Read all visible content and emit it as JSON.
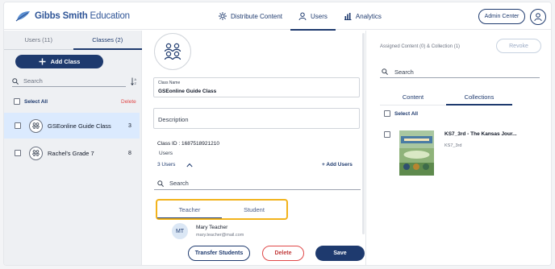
{
  "app": {
    "logo_bold": "Gibbs Smith",
    "logo_rest": " Education"
  },
  "nav": {
    "distribute": "Distribute Content",
    "users": "Users",
    "analytics": "Analytics",
    "admin_center": "Admin Center"
  },
  "left": {
    "tab_users": "Users (11)",
    "tab_classes": "Classes (2)",
    "add_class": "Add Class",
    "search_placeholder": "Search",
    "select_all": "Select All",
    "delete": "Delete",
    "classes": [
      {
        "name": "GSEonline Guide Class",
        "count": "3"
      },
      {
        "name": "Rachel's Grade 7",
        "count": "8"
      }
    ]
  },
  "detail": {
    "class_name_label": "Class Name",
    "class_name_value": "GSEonline Guide Class",
    "description_placeholder": "Description",
    "class_id": "Class ID : 1687518921210",
    "users_label": "Users",
    "users_count": "3 Users",
    "add_users": "+ Add Users",
    "search_placeholder": "Search",
    "role_teacher": "Teacher",
    "role_student": "Student",
    "member": {
      "initials": "MT",
      "name": "Mary Teacher",
      "email": "mary.teacher@mail.com"
    },
    "btn_transfer": "Transfer Students",
    "btn_delete": "Delete",
    "btn_save": "Save"
  },
  "right": {
    "assigned": "Assigned Content (0) & Collection (1)",
    "revoke": "Revoke",
    "search_placeholder": "Search",
    "tab_content": "Content",
    "tab_collections": "Collections",
    "select_all": "Select All",
    "collection": {
      "title": "KS7_3rd - The Kansas Jour...",
      "subtitle": "KS7_3rd"
    }
  },
  "colors": {
    "primary": "#1e3a6e",
    "danger": "#e04848",
    "highlight_border": "#f2b31c",
    "selected_row": "#dbeafe"
  }
}
